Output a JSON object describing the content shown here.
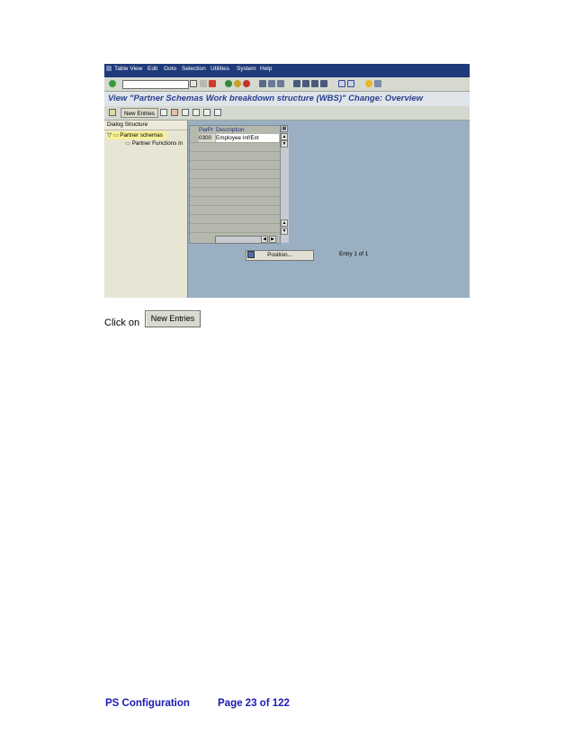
{
  "menu": [
    "Table View",
    "Edit",
    "Goto",
    "Selection",
    "Utilities",
    "System",
    "Help"
  ],
  "screen_title": "View \"Partner Schemas Work breakdown structure (WBS)\" Change: Overview",
  "app_toolbar": {
    "new_entries_label": "New Entries"
  },
  "dialog_structure": {
    "header": "Dialog Structure",
    "items": [
      {
        "label": "Partner schemas"
      },
      {
        "label": "Partner Functions in"
      }
    ]
  },
  "table": {
    "columns": [
      "ParPr",
      "Description"
    ],
    "rows": [
      {
        "parpr": "0300",
        "description": "Employee Inf/Ext"
      }
    ]
  },
  "position_button_label": "Position...",
  "entry_count": "Entry 1 of 1",
  "instruction": {
    "text": "Click on",
    "button_label": "New Entries"
  },
  "footer": {
    "left": "PS Configuration",
    "right": "Page 23 of 122"
  },
  "colors": {
    "menubar": "#1f3a7a",
    "title_text": "#2a3f8f",
    "footer_text": "#1a1ab4",
    "selection": "#f7f197"
  }
}
